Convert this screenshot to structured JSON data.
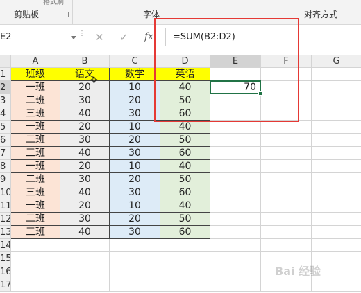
{
  "ribbon": {
    "top_partial": "格式刷",
    "groups": [
      {
        "label": "剪贴板"
      },
      {
        "label": "字体"
      },
      {
        "label": "对齐方式"
      }
    ]
  },
  "formula_bar": {
    "name_box": "E2",
    "cancel_icon": "✕",
    "confirm_icon": "✓",
    "fx_label": "fx",
    "formula": "=SUM(B2:D2)"
  },
  "columns": [
    "A",
    "B",
    "C",
    "D",
    "E",
    "F",
    "G"
  ],
  "rows": [
    "1",
    "2",
    "3",
    "4",
    "5",
    "6",
    "7",
    "8",
    "9",
    "10",
    "11",
    "12",
    "13",
    "14",
    "15",
    "16",
    "17"
  ],
  "table": {
    "headers": [
      "班级",
      "语文",
      "数学",
      "英语"
    ],
    "data": [
      [
        "一班",
        "20",
        "10",
        "40"
      ],
      [
        "二班",
        "30",
        "20",
        "50"
      ],
      [
        "三班",
        "40",
        "30",
        "60"
      ],
      [
        "一班",
        "20",
        "10",
        "40"
      ],
      [
        "二班",
        "30",
        "20",
        "50"
      ],
      [
        "三班",
        "40",
        "30",
        "60"
      ],
      [
        "一班",
        "20",
        "10",
        "40"
      ],
      [
        "二班",
        "30",
        "20",
        "50"
      ],
      [
        "三班",
        "40",
        "30",
        "60"
      ],
      [
        "一班",
        "20",
        "10",
        "40"
      ],
      [
        "二班",
        "30",
        "20",
        "50"
      ],
      [
        "三班",
        "40",
        "30",
        "60"
      ]
    ]
  },
  "e2_value": "70",
  "colors": {
    "header_yellow": "#ffff00",
    "col_a": "#fce4d6",
    "col_b": "#ededed",
    "col_c": "#ddebf7",
    "col_d": "#e2efda",
    "selection_green": "#217346",
    "annotation_red": "#e53935"
  },
  "watermark": "Bai 经验"
}
